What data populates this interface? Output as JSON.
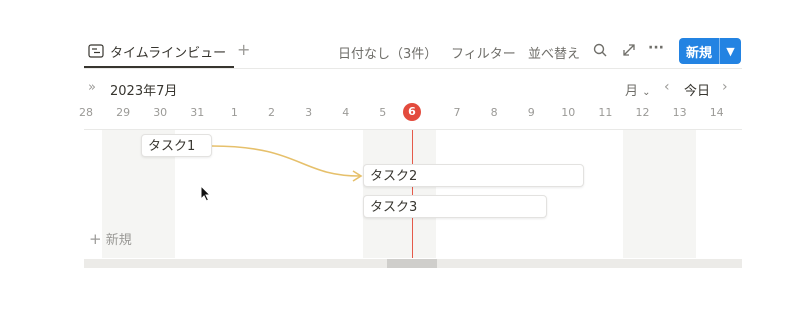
{
  "tab": {
    "icon": "timeline-view-icon",
    "label": "タイムラインビュー"
  },
  "toolbar": {
    "no_date": "日付なし（3件）",
    "filter": "フィルター",
    "sort": "並べ替え",
    "new_label": "新規",
    "accent": "#2383e2"
  },
  "nav": {
    "month_label": "2023年7月",
    "scale": "月",
    "today": "今日"
  },
  "days": [
    "28",
    "29",
    "30",
    "31",
    "1",
    "2",
    "3",
    "4",
    "5",
    "6",
    "7",
    "8",
    "9",
    "10",
    "11",
    "12",
    "13",
    "14"
  ],
  "today_day": "6",
  "tasks": [
    {
      "name": "タスク1"
    },
    {
      "name": "タスク2"
    },
    {
      "name": "タスク3"
    }
  ],
  "new_row": "新規",
  "colors": {
    "today": "#e34b3d",
    "dependency": "#e6c06b"
  }
}
